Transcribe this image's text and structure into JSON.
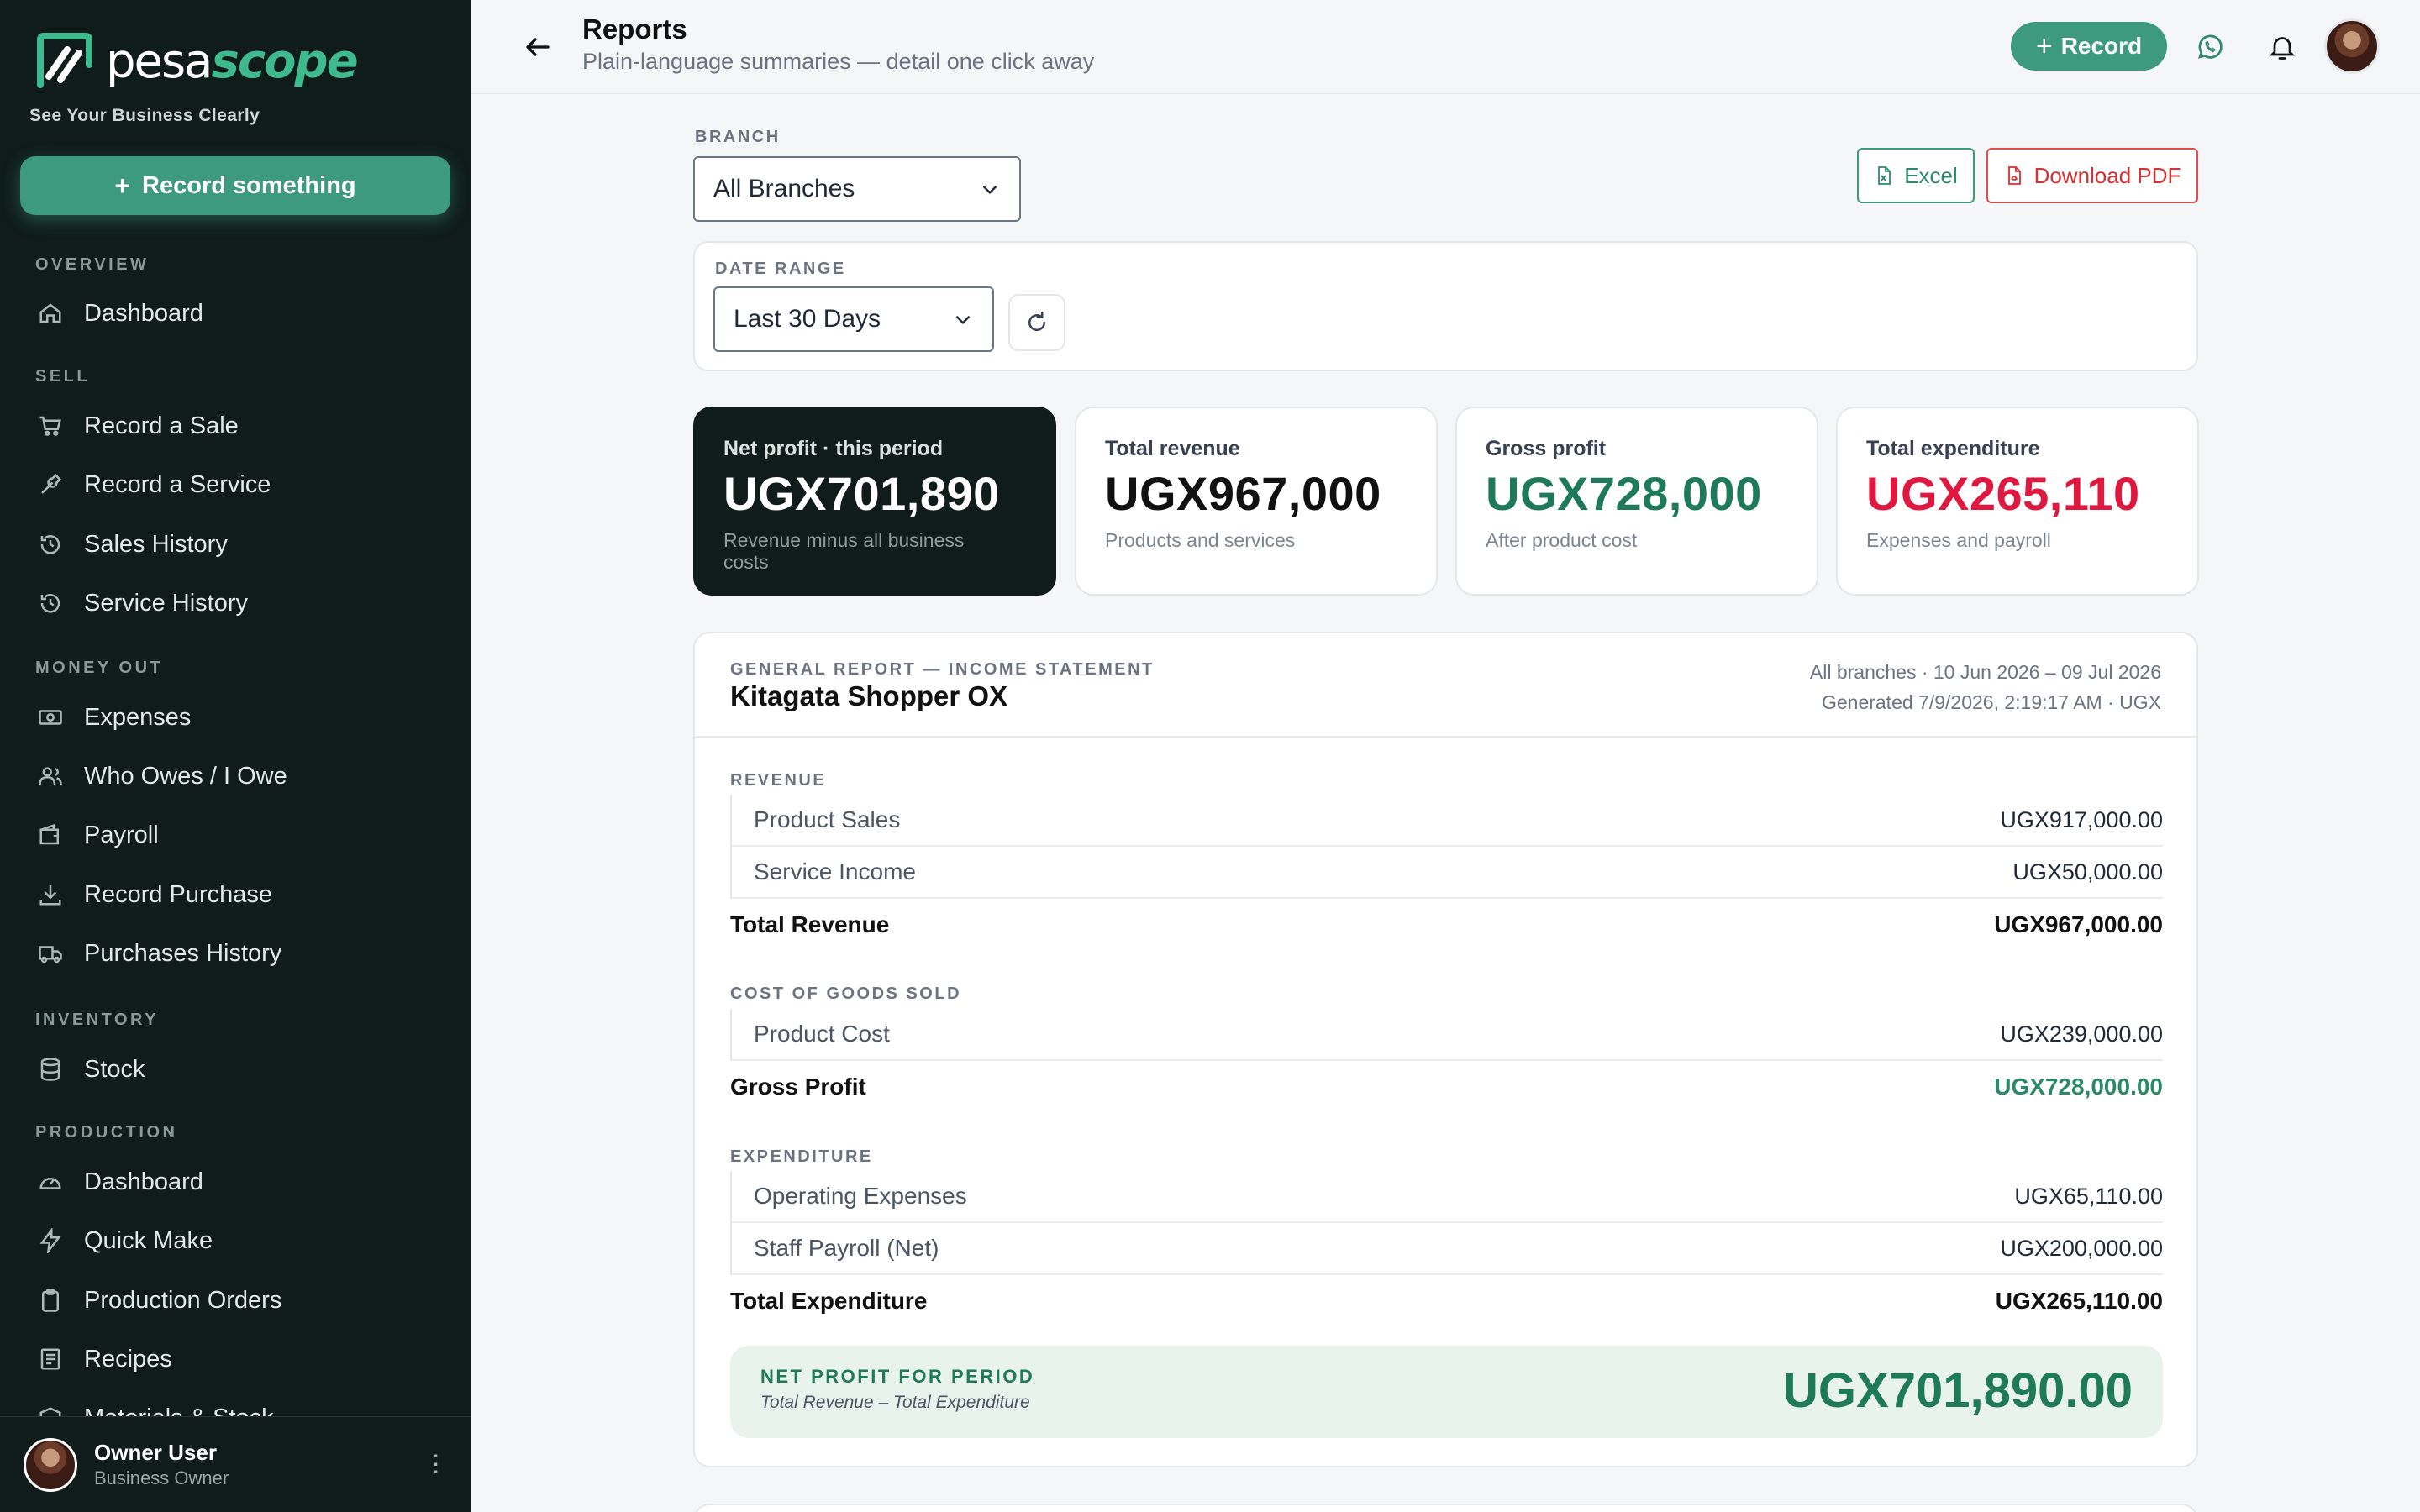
{
  "brand": {
    "name_part1": "pesa",
    "name_part2": "scope",
    "tagline": "See Your Business Clearly"
  },
  "sidebar": {
    "record_button": "Record something",
    "sections": {
      "overview": "OVERVIEW",
      "sell": "SELL",
      "money_out": "MONEY OUT",
      "inventory": "INVENTORY",
      "production": "PRODUCTION"
    },
    "items": {
      "dashboard": "Dashboard",
      "record_sale": "Record a Sale",
      "record_service": "Record a Service",
      "sales_history": "Sales History",
      "service_history": "Service History",
      "expenses": "Expenses",
      "who_owes": "Who Owes / I Owe",
      "payroll": "Payroll",
      "record_purchase": "Record Purchase",
      "purchases_history": "Purchases History",
      "stock": "Stock",
      "prod_dashboard": "Dashboard",
      "quick_make": "Quick Make",
      "production_orders": "Production Orders",
      "recipes": "Recipes",
      "materials_stock": "Materials & Stock"
    },
    "user": {
      "name": "Owner User",
      "role": "Business Owner"
    }
  },
  "header": {
    "title": "Reports",
    "subtitle": "Plain-language summaries — detail one click away",
    "record_button": "Record"
  },
  "filters": {
    "branch_label": "BRANCH",
    "branch_value": "All Branches",
    "date_label": "DATE RANGE",
    "date_value": "Last 30 Days",
    "excel_button": "Excel",
    "pdf_button": "Download PDF"
  },
  "kpis": {
    "net_profit": {
      "label": "Net profit · this period",
      "value": "UGX701,890",
      "sub": "Revenue minus all business costs"
    },
    "revenue": {
      "label": "Total revenue",
      "value": "UGX967,000",
      "sub": "Products and services"
    },
    "gross": {
      "label": "Gross profit",
      "value": "UGX728,000",
      "sub": "After product cost"
    },
    "expenditure": {
      "label": "Total expenditure",
      "value": "UGX265,110",
      "sub": "Expenses and payroll"
    }
  },
  "report": {
    "kicker": "GENERAL REPORT — INCOME STATEMENT",
    "company": "Kitagata Shopper OX",
    "meta_line1": "All branches · 10 Jun 2026 – 09 Jul 2026",
    "meta_line2": "Generated 7/9/2026, 2:19:17 AM · UGX",
    "revenue_label": "REVENUE",
    "product_sales": {
      "name": "Product Sales",
      "amount": "UGX917,000.00"
    },
    "service_income": {
      "name": "Service Income",
      "amount": "UGX50,000.00"
    },
    "total_revenue": {
      "name": "Total Revenue",
      "amount": "UGX967,000.00"
    },
    "cogs_label": "COST OF GOODS SOLD",
    "product_cost": {
      "name": "Product Cost",
      "amount": "UGX239,000.00"
    },
    "gross_profit": {
      "name": "Gross Profit",
      "amount": "UGX728,000.00"
    },
    "expenditure_label": "EXPENDITURE",
    "operating_expenses": {
      "name": "Operating Expenses",
      "amount": "UGX65,110.00"
    },
    "staff_payroll": {
      "name": "Staff Payroll (Net)",
      "amount": "UGX200,000.00"
    },
    "total_expenditure": {
      "name": "Total Expenditure",
      "amount": "UGX265,110.00"
    },
    "net_title": "NET PROFIT FOR PERIOD",
    "net_sub": "Total Revenue – Total Expenditure",
    "net_amount": "UGX701,890.00"
  },
  "colors": {
    "sidebar_bg": "#0f1c19",
    "accent_green": "#3d9a7d",
    "profit_green": "#1f7a59",
    "expense_red": "#e0173f",
    "pdf_red": "#d63030"
  }
}
